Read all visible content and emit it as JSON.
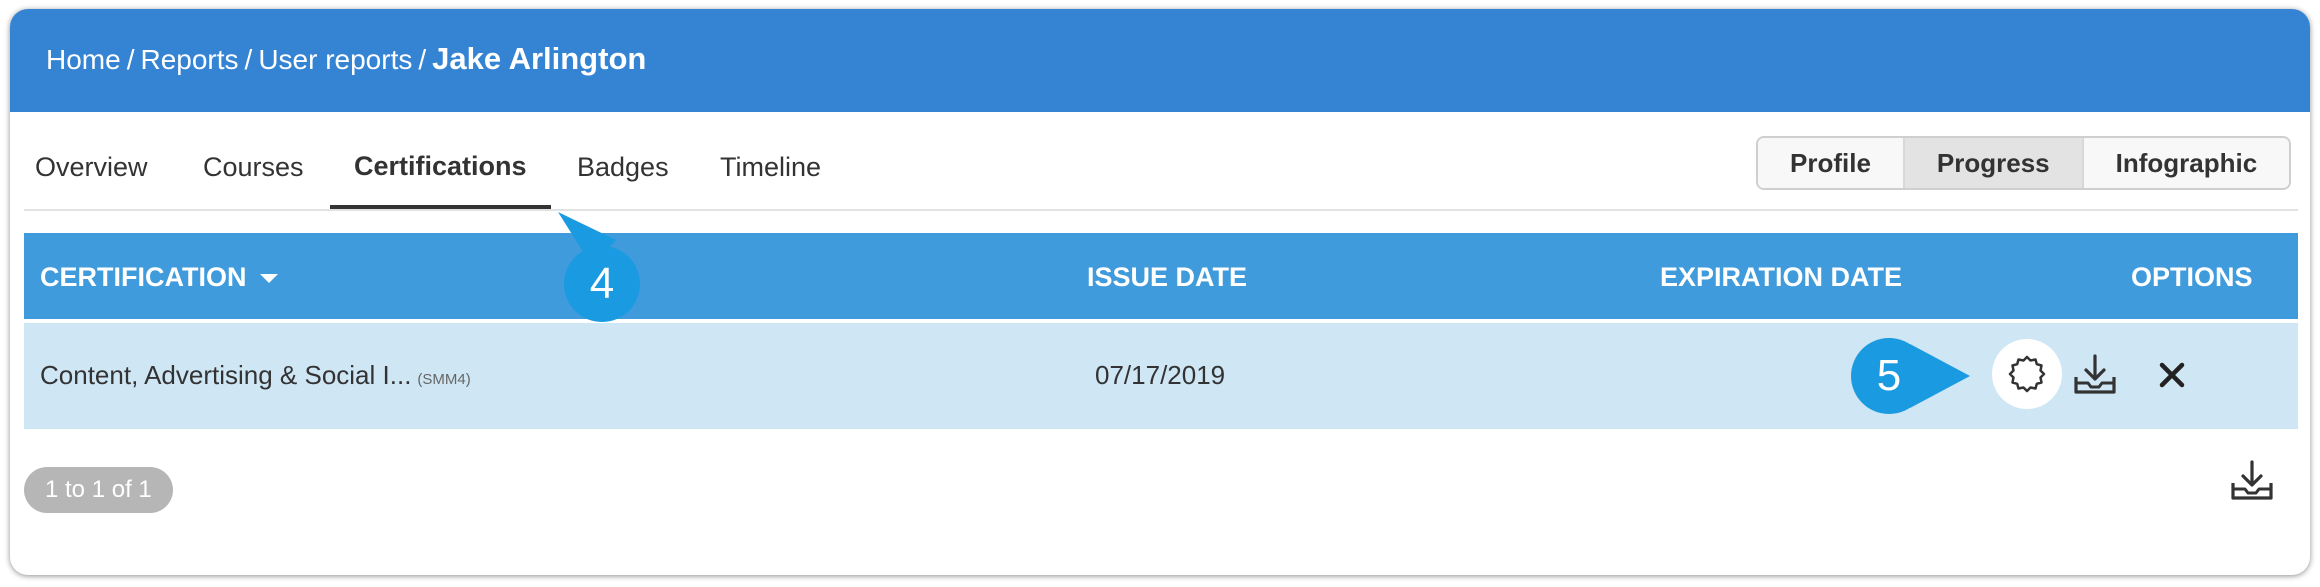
{
  "breadcrumb": {
    "items": [
      "Home",
      "Reports",
      "User reports"
    ],
    "separator": "/",
    "current": "Jake Arlington"
  },
  "tabs": [
    {
      "label": "Overview"
    },
    {
      "label": "Courses"
    },
    {
      "label": "Certifications",
      "active": true
    },
    {
      "label": "Badges"
    },
    {
      "label": "Timeline"
    }
  ],
  "view_toggle": [
    {
      "label": "Profile"
    },
    {
      "label": "Progress",
      "active": true
    },
    {
      "label": "Infographic"
    }
  ],
  "table": {
    "columns": [
      "CERTIFICATION",
      "ISSUE DATE",
      "EXPIRATION DATE",
      "OPTIONS"
    ],
    "rows": [
      {
        "name": "Content, Advertising & Social I...",
        "code": "(SMM4)",
        "issue_date": "07/17/2019",
        "expiration_date": ""
      }
    ],
    "option_icons": [
      "certificate-badge-icon",
      "download-tray-icon",
      "close-icon"
    ]
  },
  "pager": {
    "label": "1 to 1 of 1"
  },
  "callouts": [
    "4",
    "5"
  ],
  "colors": {
    "header": "#3584d4",
    "table_head": "#3f9bdb",
    "row": "#cfe6f4",
    "callout": "#1a9ae0"
  }
}
